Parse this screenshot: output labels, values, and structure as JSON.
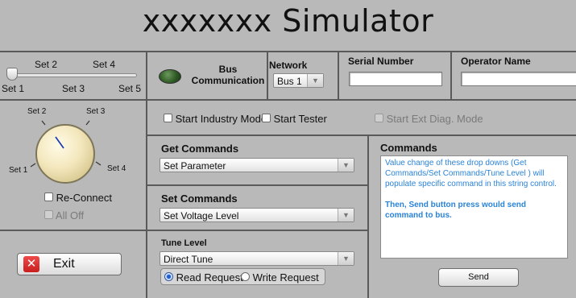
{
  "title": "xxxxxxx Simulator",
  "slider": {
    "labels_top": [
      "Set 2",
      "Set 4"
    ],
    "labels_bottom": [
      "Set 1",
      "Set 3",
      "Set 5"
    ],
    "value": 1
  },
  "bus": {
    "label_line1": "Bus",
    "label_line2": "Communication",
    "led_color": "#2f5a25"
  },
  "network": {
    "label": "Network",
    "value": "Bus 1"
  },
  "serial_number": {
    "label": "Serial Number",
    "value": ""
  },
  "operator_name": {
    "label": "Operator Name",
    "value": ""
  },
  "knob": {
    "labels": {
      "set1": "Set 1",
      "set2": "Set 2",
      "set3": "Set 3",
      "set4": "Set 4"
    },
    "value": "Set 2"
  },
  "reconnect": {
    "label": "Re-Connect",
    "checked": false
  },
  "all_off": {
    "label": "All Off",
    "checked": false,
    "disabled": true
  },
  "exit": {
    "label": "Exit",
    "icon": "x-icon",
    "icon_color": "#d92a2a"
  },
  "modes": {
    "industry": "Start Industry Mode",
    "tester": "Start Tester",
    "ext_diag": "Start Ext Diag. Mode"
  },
  "get_commands": {
    "label": "Get Commands",
    "value": "Set Parameter"
  },
  "set_commands": {
    "label": "Set Commands",
    "value": "Set Voltage Level"
  },
  "tune_level": {
    "label": "Tune Level",
    "value": "Direct Tune"
  },
  "request": {
    "read": "Read Request",
    "write": "Write Request",
    "selected": "read"
  },
  "commands": {
    "label": "Commands",
    "text_line1": "Value change of these drop downs (Get Commands/Set Commands/Tune Level ) will populate specific command in this string control.",
    "text_line2": "Then, Send button press would send command to bus."
  },
  "send": {
    "label": "Send"
  },
  "colors": {
    "background": "#b9b9b9",
    "info_text": "#2a83d8"
  }
}
